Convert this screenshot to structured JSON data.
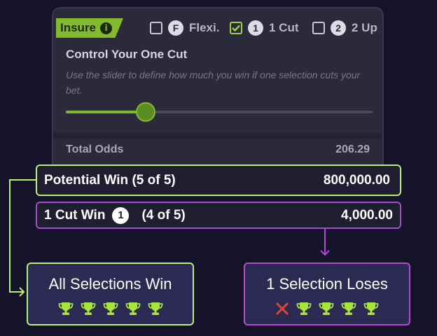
{
  "insure": {
    "label": "Insure",
    "info_icon": "info-icon"
  },
  "options": [
    {
      "label": "Flexi.",
      "badge": "F",
      "checked": false
    },
    {
      "label": "1 Cut",
      "badge": "1",
      "checked": true
    },
    {
      "label": "2 Up",
      "badge": "2",
      "checked": false
    }
  ],
  "control": {
    "title": "Control Your One Cut",
    "description": "Use the slider to define how much you win if one selection cuts your bet.",
    "slider_fraction": 0.26
  },
  "total_odds": {
    "label": "Total Odds",
    "value": "206.29"
  },
  "potential_win": {
    "label": "Potential Win (5 of 5)",
    "value": "800,000.00"
  },
  "cut_win": {
    "label": "1 Cut Win",
    "badge": "1",
    "count": "(4 of 5)",
    "value": "4,000.00"
  },
  "all_win": {
    "title": "All Selections Win",
    "icons": [
      "trophy-icon",
      "trophy-icon",
      "trophy-icon",
      "trophy-icon",
      "trophy-icon"
    ]
  },
  "one_loses": {
    "title": "1 Selection Loses",
    "icons": [
      "cross-icon",
      "trophy-icon",
      "trophy-icon",
      "trophy-icon",
      "trophy-icon"
    ]
  },
  "colors": {
    "green": "#b8f077",
    "accent_green": "#83b92e",
    "purple": "#b54ad0",
    "cross": "#e0453a"
  }
}
